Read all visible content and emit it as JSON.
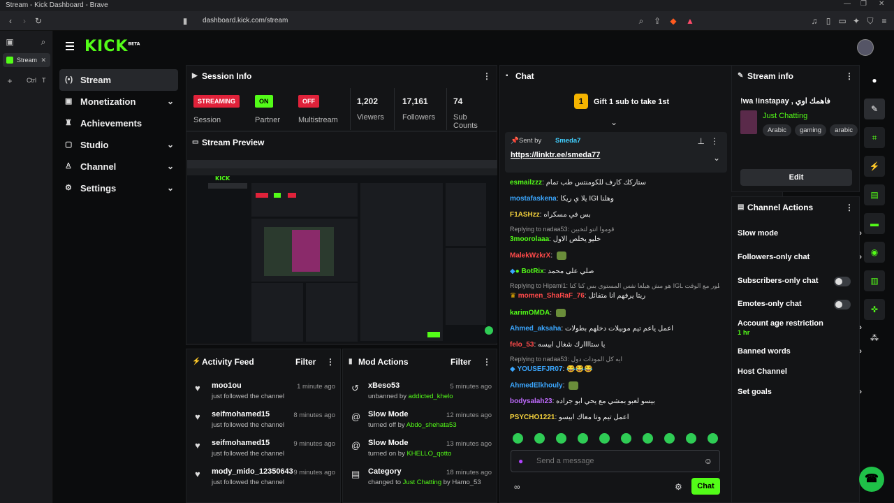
{
  "browser": {
    "window_title": "Stream - Kick Dashboard - Brave",
    "url": "dashboard.kick.com/stream",
    "tab_title": "Stream",
    "shortcut_ctrl": "Ctrl",
    "shortcut_key": "T"
  },
  "app": {
    "logo": "KICK",
    "logo_badge": "BETA"
  },
  "sidebar": {
    "items": [
      {
        "label": "Stream",
        "icon": "broadcast-icon",
        "active": true,
        "expandable": false
      },
      {
        "label": "Monetization",
        "icon": "dollar-icon",
        "expandable": true
      },
      {
        "label": "Achievements",
        "icon": "trophy-icon",
        "expandable": false
      },
      {
        "label": "Studio",
        "icon": "camera-icon",
        "expandable": true
      },
      {
        "label": "Channel",
        "icon": "users-icon",
        "expandable": true
      },
      {
        "label": "Settings",
        "icon": "gear-icon",
        "expandable": true
      }
    ]
  },
  "session_info": {
    "title": "Session Info",
    "streaming_badge": "STREAMING",
    "session_label": "Session",
    "partner_badge": "ON",
    "partner_label": "Partner",
    "multistream_badge": "OFF",
    "multistream_label": "Multistream",
    "viewers": "1,202",
    "viewers_label": "Viewers",
    "followers": "17,161",
    "followers_label": "Followers",
    "sub_count": "74",
    "sub_label": "Sub Counts"
  },
  "preview": {
    "title": "Stream Preview"
  },
  "activity_feed": {
    "title": "Activity Feed",
    "filter_label": "Filter",
    "rows": [
      {
        "name": "moo1ou",
        "sub": "just followed the channel",
        "time": "1 minute ago"
      },
      {
        "name": "seifmohamed15",
        "sub": "just followed the channel",
        "time": "8 minutes ago"
      },
      {
        "name": "seifmohamed15",
        "sub": "just followed the channel",
        "time": "9 minutes ago"
      },
      {
        "name": "mody_mido_12350643",
        "sub": "just followed the channel",
        "time": "9 minutes ago"
      }
    ]
  },
  "mod_actions": {
    "title": "Mod Actions",
    "filter_label": "Filter",
    "rows": [
      {
        "name": "xBeso53",
        "sub_prefix": "unbanned by ",
        "sub_user": "addicted_khelo",
        "sub_suffix": "",
        "time": "5 minutes ago",
        "icon": "undo-icon"
      },
      {
        "name": "Slow Mode",
        "sub_prefix": "turned off by ",
        "sub_user": "Abdo_shehata53",
        "sub_suffix": "",
        "time": "12 minutes ago",
        "icon": "snail-icon"
      },
      {
        "name": "Slow Mode",
        "sub_prefix": "turned on by ",
        "sub_user": "KHELLO_qotto",
        "sub_suffix": "",
        "time": "13 minutes ago",
        "icon": "snail-icon"
      },
      {
        "name": "Category",
        "sub_prefix": "changed to ",
        "sub_user": "Just Chatting",
        "sub_suffix": " by Hamo_53",
        "time": "18 minutes ago",
        "icon": "category-icon"
      }
    ]
  },
  "chat": {
    "title": "Chat",
    "gift_rank": "1",
    "gift_text": "Gift 1 sub to take 1st",
    "pinned_prefix": "Sent by",
    "pinned_user": "Smeda7",
    "pinned_link": "https://linktr.ee/smeda77",
    "messages": [
      {
        "user": "esmailzzz",
        "cls": "u-green",
        "text": "ستاركك كارف للكومنتس طب تمام",
        "reply": ""
      },
      {
        "user": "mostafaskena",
        "cls": "u-blue",
        "text": "يلا ي ريكا IGI وهلنا",
        "reply": ""
      },
      {
        "user": "F1ASHzz",
        "cls": "u-yellow",
        "text": "بس في مسكراه",
        "reply": ""
      },
      {
        "user": "3moorolaaa",
        "cls": "u-green",
        "text": "خليو يخلص الاول",
        "reply": "Replying to nadaa53: قوموا انتو لتخبين"
      },
      {
        "user": "MalekWzkrX",
        "cls": "u-red",
        "text": "",
        "reply": ""
      },
      {
        "user": "BotRix",
        "cls": "u-green",
        "text": "صلي على محمد",
        "reply": ""
      },
      {
        "user": "momen_ShaRaF_76",
        "cls": "u-red",
        "text": "ريتا يرفهم انا متفائل",
        "reply": "Replying to Hipami1: هو مش هيلعا نفس المستوي بس كنا كنا IGL هيطور مع الوقت..."
      },
      {
        "user": "karimOMDA",
        "cls": "u-green",
        "text": "",
        "reply": ""
      },
      {
        "user": "Ahmed_aksaha",
        "cls": "u-blue",
        "text": "اعمل ياعم تيم موبيلات دخلهم بطولات",
        "reply": ""
      },
      {
        "user": "felo_53",
        "cls": "u-red",
        "text": "يا ستاااارك شغال ابيسه",
        "reply": ""
      },
      {
        "user": "YOUSEFJR07",
        "cls": "u-blue",
        "text": "😂😂😂",
        "reply": "Replying to nadaa53: ايه كل المودات دول"
      },
      {
        "user": "AhmedElkhouly",
        "cls": "u-blue",
        "text": "",
        "reply": ""
      },
      {
        "user": "bodysalah23",
        "cls": "u-purple",
        "text": "بيسو لعبو بمشي مع يحي ابو جراده",
        "reply": ""
      },
      {
        "user": "PSYCHO1221",
        "cls": "u-yellow",
        "text": "اعمل تيم وتا معاك ابيسو",
        "reply": ""
      }
    ],
    "input_placeholder": "Send a message",
    "send_label": "Chat"
  },
  "stream_info": {
    "title": "Stream info",
    "stream_title": "!wa !instapay , فاهمك اوي",
    "category": "Just Chatting",
    "tags": [
      "Arabic",
      "gaming",
      "arabic"
    ],
    "edit_label": "Edit"
  },
  "channel_actions": {
    "title": "Channel Actions",
    "items": [
      {
        "label": "Slow mode",
        "type": "chevron",
        "sub": ""
      },
      {
        "label": "Followers-only chat",
        "type": "chevron",
        "sub": ""
      },
      {
        "label": "Subscribers-only chat",
        "type": "toggle",
        "sub": ""
      },
      {
        "label": "Emotes-only chat",
        "type": "toggle",
        "sub": ""
      },
      {
        "label": "Account age restriction",
        "type": "chevron",
        "sub": "1 hr"
      },
      {
        "label": "Banned words",
        "type": "chevron",
        "sub": ""
      },
      {
        "label": "Host Channel",
        "type": "none",
        "sub": ""
      },
      {
        "label": "Set goals",
        "type": "chevron",
        "sub": ""
      }
    ]
  },
  "colors": {
    "accent": "#53fc18",
    "live_red": "#e0223a"
  }
}
